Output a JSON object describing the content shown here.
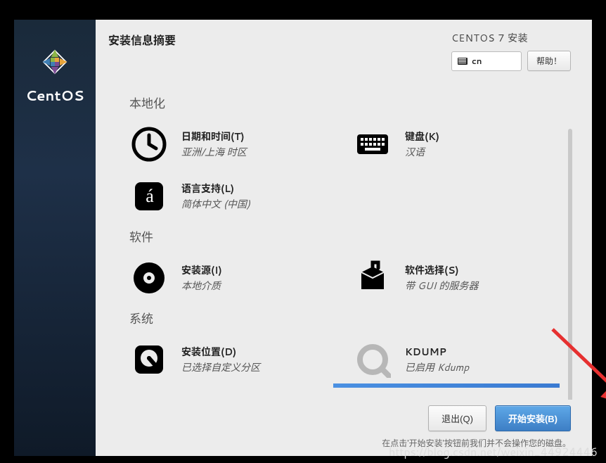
{
  "sidebar": {
    "brand": "CentOS"
  },
  "header": {
    "title": "安装信息摘要",
    "brand": "CENTOS 7 安装",
    "lang_code": "cn",
    "help_label": "帮助！"
  },
  "sections": {
    "localization": {
      "title": "本地化",
      "datetime": {
        "title": "日期和时间(T)",
        "sub": "亚洲/上海 时区"
      },
      "keyboard": {
        "title": "键盘(K)",
        "sub": "汉语"
      },
      "language": {
        "title": "语言支持(L)",
        "sub": "简体中文 (中国)"
      }
    },
    "software": {
      "title": "软件",
      "source": {
        "title": "安装源(I)",
        "sub": "本地介质"
      },
      "selection": {
        "title": "软件选择(S)",
        "sub": "带 GUI 的服务器"
      }
    },
    "system": {
      "title": "系统",
      "destination": {
        "title": "安装位置(D)",
        "sub": "已选择自定义分区"
      },
      "kdump": {
        "title": "KDUMP",
        "sub": "已启用 Kdump"
      }
    }
  },
  "footer": {
    "quit_label": "退出(Q)",
    "begin_label": "开始安装(B)",
    "note": "在点击'开始安装'按钮前我们并不会操作您的磁盘。"
  },
  "watermark": "https://blog.csdn.net/weixin_44924446",
  "annotation": {
    "arrow_color": "#e63030"
  }
}
